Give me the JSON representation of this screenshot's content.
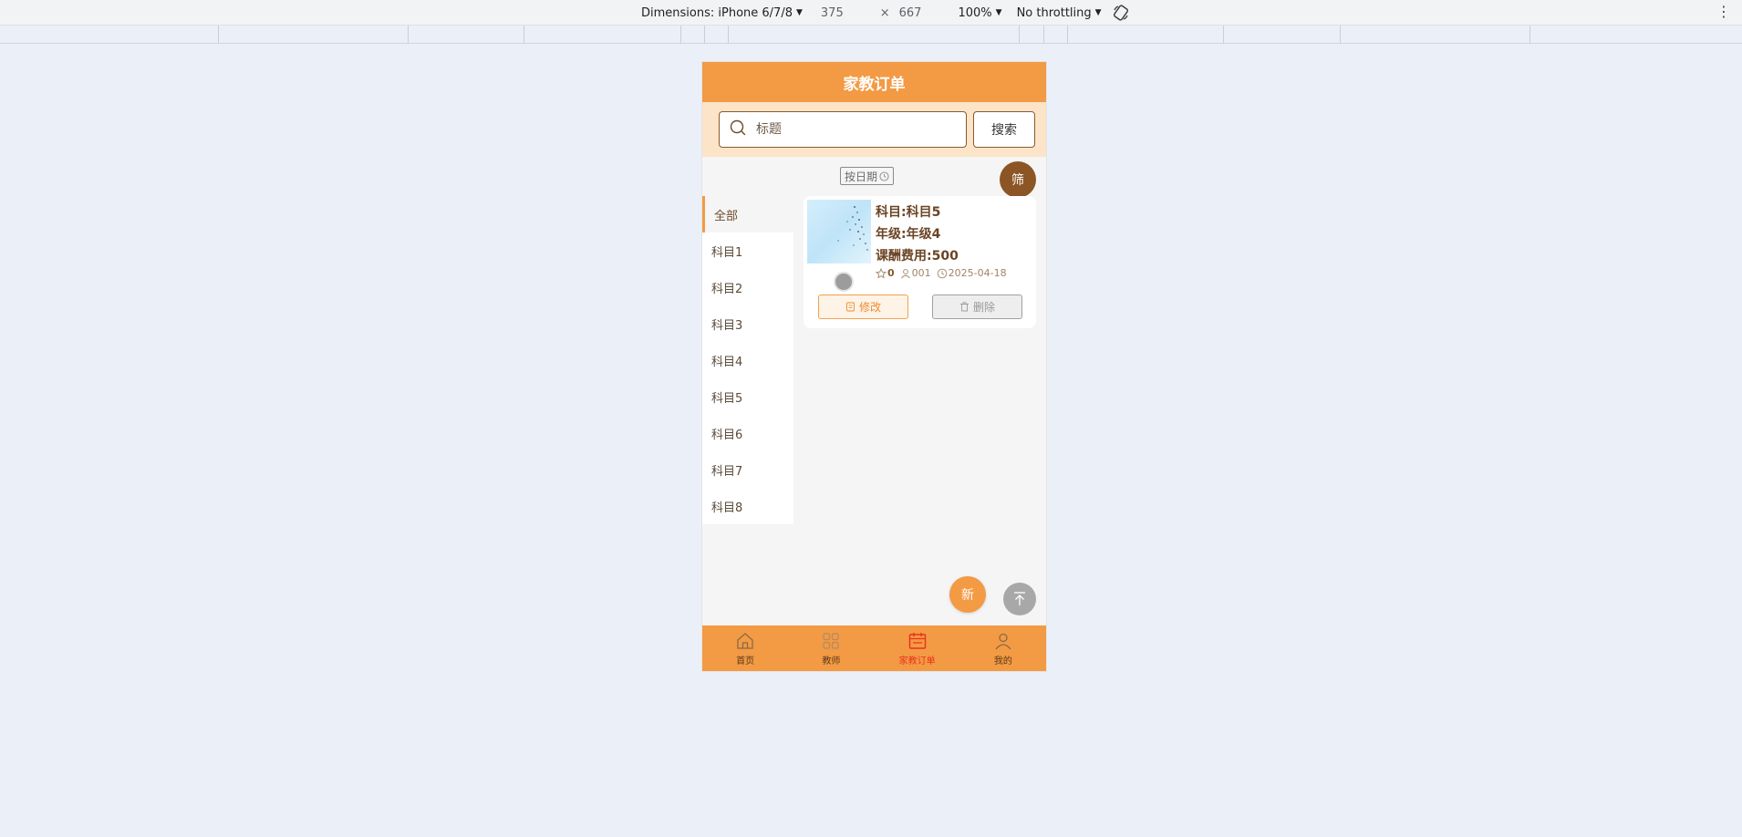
{
  "devtools": {
    "device_label": "Dimensions: iPhone 6/7/8",
    "width": "375",
    "times": "×",
    "height": "667",
    "zoom": "100%",
    "throttling": "No throttling"
  },
  "app": {
    "title": "家教订单",
    "search": {
      "placeholder": "标题",
      "button_label": "搜索"
    },
    "sort_label": "按日期",
    "filter_label": "筛",
    "categories": [
      {
        "label": "全部"
      },
      {
        "label": "科目1"
      },
      {
        "label": "科目2"
      },
      {
        "label": "科目3"
      },
      {
        "label": "科目4"
      },
      {
        "label": "科目5"
      },
      {
        "label": "科目6"
      },
      {
        "label": "科目7"
      },
      {
        "label": "科目8"
      }
    ],
    "active_category": "全部",
    "order_card": {
      "subject": "科目:科目5",
      "grade": "年级:年级4",
      "fee": "课酬费用:500",
      "likes": "0",
      "user": "001",
      "date": "2025-04-18",
      "edit_label": "修改",
      "delete_label": "删除"
    },
    "new_label": "新",
    "tabbar": [
      {
        "label": "首页",
        "icon": "home-icon"
      },
      {
        "label": "教师",
        "icon": "grid-icon"
      },
      {
        "label": "家教订单",
        "icon": "calendar-icon"
      },
      {
        "label": "我的",
        "icon": "user-icon"
      }
    ],
    "active_tab": "家教订单",
    "colors": {
      "primary": "#f39a44",
      "search_bg": "#fbe4c8",
      "brown": "#8b5525",
      "active_tab": "#e8321e"
    }
  }
}
